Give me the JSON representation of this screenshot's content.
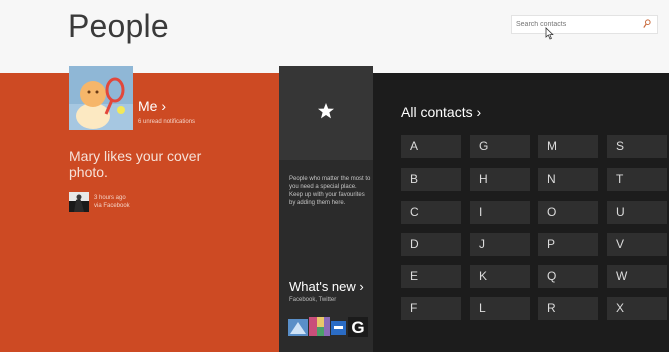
{
  "header": {
    "title": "People",
    "search": {
      "placeholder": "Search contacts"
    }
  },
  "me": {
    "label": "Me ›",
    "subtitle": "6 unread notifications"
  },
  "notification": {
    "text": "Mary likes your cover photo.",
    "time": "3 hours ago",
    "via": "via Facebook"
  },
  "favorites": {
    "description": "People who matter the most to you need a special place. Keep up with your favourites by adding them here."
  },
  "whats_new": {
    "label": "What's new ›",
    "sources": "Facebook, Twitter"
  },
  "contacts": {
    "label": "All contacts ›",
    "letters": [
      "A",
      "B",
      "C",
      "D",
      "E",
      "F",
      "G",
      "H",
      "I",
      "J",
      "K",
      "L",
      "M",
      "N",
      "O",
      "P",
      "Q",
      "R",
      "S",
      "T",
      "U",
      "V",
      "W",
      "X"
    ]
  },
  "colors": {
    "accent": "#cd4a23",
    "dark_panel": "#1c1c1c",
    "tile": "#2f2f2f"
  }
}
